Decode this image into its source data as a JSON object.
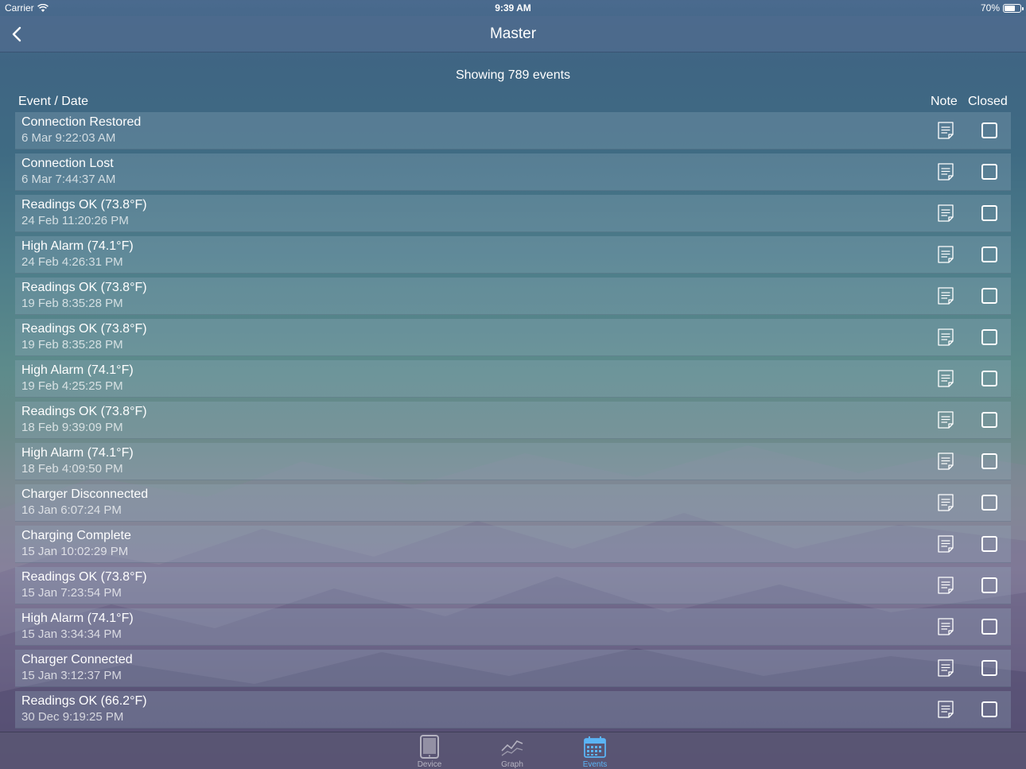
{
  "status_bar": {
    "carrier": "Carrier",
    "time": "9:39 AM",
    "battery_text": "70%",
    "battery_level": 0.7
  },
  "nav": {
    "title": "Master",
    "back_icon": "chevron-left-icon"
  },
  "summary": "Showing 789 events",
  "columns": {
    "event": "Event / Date",
    "note": "Note",
    "closed": "Closed"
  },
  "events": [
    {
      "title": "Connection Restored",
      "date": "6 Mar 9:22:03 AM",
      "closed": false
    },
    {
      "title": "Connection Lost",
      "date": "6 Mar 7:44:37 AM",
      "closed": false
    },
    {
      "title": "Readings OK (73.8°F)",
      "date": "24 Feb 11:20:26 PM",
      "closed": false
    },
    {
      "title": "High Alarm (74.1°F)",
      "date": "24 Feb 4:26:31 PM",
      "closed": false
    },
    {
      "title": "Readings OK (73.8°F)",
      "date": "19 Feb 8:35:28 PM",
      "closed": false
    },
    {
      "title": "Readings OK (73.8°F)",
      "date": "19 Feb 8:35:28 PM",
      "closed": false
    },
    {
      "title": "High Alarm (74.1°F)",
      "date": "19 Feb 4:25:25 PM",
      "closed": false
    },
    {
      "title": "Readings OK (73.8°F)",
      "date": "18 Feb 9:39:09 PM",
      "closed": false
    },
    {
      "title": "High Alarm (74.1°F)",
      "date": "18 Feb 4:09:50 PM",
      "closed": false
    },
    {
      "title": "Charger Disconnected",
      "date": "16 Jan 6:07:24 PM",
      "closed": false
    },
    {
      "title": "Charging Complete",
      "date": "15 Jan 10:02:29 PM",
      "closed": false
    },
    {
      "title": "Readings OK (73.8°F)",
      "date": "15 Jan 7:23:54 PM",
      "closed": false
    },
    {
      "title": "High Alarm (74.1°F)",
      "date": "15 Jan 3:34:34 PM",
      "closed": false
    },
    {
      "title": "Charger Connected",
      "date": "15 Jan 3:12:37 PM",
      "closed": false
    },
    {
      "title": "Readings OK (66.2°F)",
      "date": "30 Dec 9:19:25 PM",
      "closed": false
    }
  ],
  "tabs": [
    {
      "label": "Device",
      "icon": "tablet-icon",
      "active": false
    },
    {
      "label": "Graph",
      "icon": "line-graph-icon",
      "active": false
    },
    {
      "label": "Events",
      "icon": "calendar-icon",
      "active": true
    }
  ],
  "colors": {
    "accent": "#5bb4f5",
    "nav_bg": "#4e6b8d"
  }
}
